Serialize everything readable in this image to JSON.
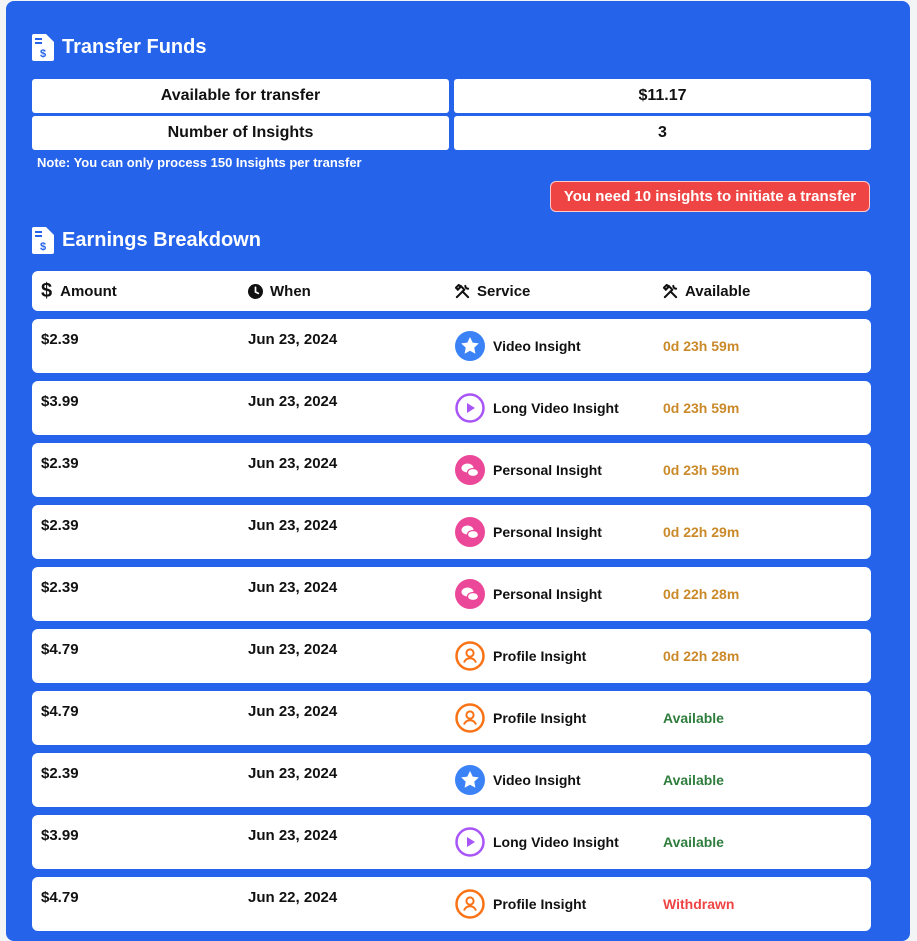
{
  "transfer": {
    "title": "Transfer Funds",
    "available_label": "Available for transfer",
    "available_value": "$11.17",
    "insights_label": "Number of Insights",
    "insights_value": "3",
    "note": "Note: You can only process 150 Insights per transfer",
    "warning_button": "You need 10 insights to initiate a transfer"
  },
  "earnings": {
    "title": "Earnings Breakdown",
    "columns": {
      "amount": "Amount",
      "when": "When",
      "service": "Service",
      "available": "Available"
    },
    "rows": [
      {
        "amount": "$2.39",
        "when": "Jun 23, 2024",
        "service": "Video Insight",
        "icon": "star",
        "available": "0d 23h 59m",
        "status": "pending"
      },
      {
        "amount": "$3.99",
        "when": "Jun 23, 2024",
        "service": "Long Video Insight",
        "icon": "play",
        "available": "0d 23h 59m",
        "status": "pending"
      },
      {
        "amount": "$2.39",
        "when": "Jun 23, 2024",
        "service": "Personal Insight",
        "icon": "chat",
        "available": "0d 23h 59m",
        "status": "pending"
      },
      {
        "amount": "$2.39",
        "when": "Jun 23, 2024",
        "service": "Personal Insight",
        "icon": "chat",
        "available": "0d 22h 29m",
        "status": "pending"
      },
      {
        "amount": "$2.39",
        "when": "Jun 23, 2024",
        "service": "Personal Insight",
        "icon": "chat",
        "available": "0d 22h 28m",
        "status": "pending"
      },
      {
        "amount": "$4.79",
        "when": "Jun 23, 2024",
        "service": "Profile Insight",
        "icon": "user",
        "available": "0d 22h 28m",
        "status": "pending"
      },
      {
        "amount": "$4.79",
        "when": "Jun 23, 2024",
        "service": "Profile Insight",
        "icon": "user",
        "available": "Available",
        "status": "available"
      },
      {
        "amount": "$2.39",
        "when": "Jun 23, 2024",
        "service": "Video Insight",
        "icon": "star",
        "available": "Available",
        "status": "available"
      },
      {
        "amount": "$3.99",
        "when": "Jun 23, 2024",
        "service": "Long Video Insight",
        "icon": "play",
        "available": "Available",
        "status": "available"
      },
      {
        "amount": "$4.79",
        "when": "Jun 22, 2024",
        "service": "Profile Insight",
        "icon": "user",
        "available": "Withdrawn",
        "status": "withdrawn"
      }
    ]
  },
  "colors": {
    "panel": "#2563eb",
    "pending": "#ca8a2a",
    "available": "#2f7d3d",
    "withdrawn": "#ef4444",
    "star_icon": "#3b82f6",
    "play_icon": "#a855f7",
    "chat_icon": "#ec4899",
    "user_icon": "#f97316"
  }
}
